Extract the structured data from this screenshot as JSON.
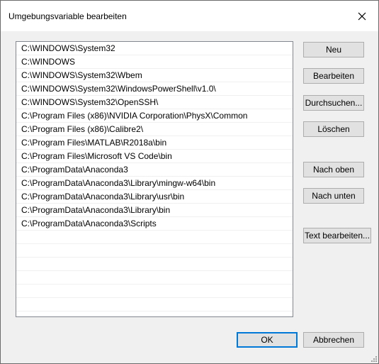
{
  "dialog": {
    "title": "Umgebungsvariable bearbeiten"
  },
  "paths": [
    "C:\\WINDOWS\\System32",
    "C:\\WINDOWS",
    "C:\\WINDOWS\\System32\\Wbem",
    "C:\\WINDOWS\\System32\\WindowsPowerShell\\v1.0\\",
    "C:\\WINDOWS\\System32\\OpenSSH\\",
    "C:\\Program Files (x86)\\NVIDIA Corporation\\PhysX\\Common",
    "C:\\Program Files (x86)\\Calibre2\\",
    "C:\\Program Files\\MATLAB\\R2018a\\bin",
    "C:\\Program Files\\Microsoft VS Code\\bin",
    "C:\\ProgramData\\Anaconda3",
    "C:\\ProgramData\\Anaconda3\\Library\\mingw-w64\\bin",
    "C:\\ProgramData\\Anaconda3\\Library\\usr\\bin",
    "C:\\ProgramData\\Anaconda3\\Library\\bin",
    "C:\\ProgramData\\Anaconda3\\Scripts",
    "",
    "",
    "",
    "",
    "",
    "",
    ""
  ],
  "buttons": {
    "new": "Neu",
    "edit": "Bearbeiten",
    "browse": "Durchsuchen...",
    "delete": "Löschen",
    "move_up": "Nach oben",
    "move_down": "Nach unten",
    "edit_text": "Text bearbeiten...",
    "ok": "OK",
    "cancel": "Abbrechen"
  },
  "icons": {
    "close": "close-icon",
    "resize": "resize-grip-icon"
  }
}
